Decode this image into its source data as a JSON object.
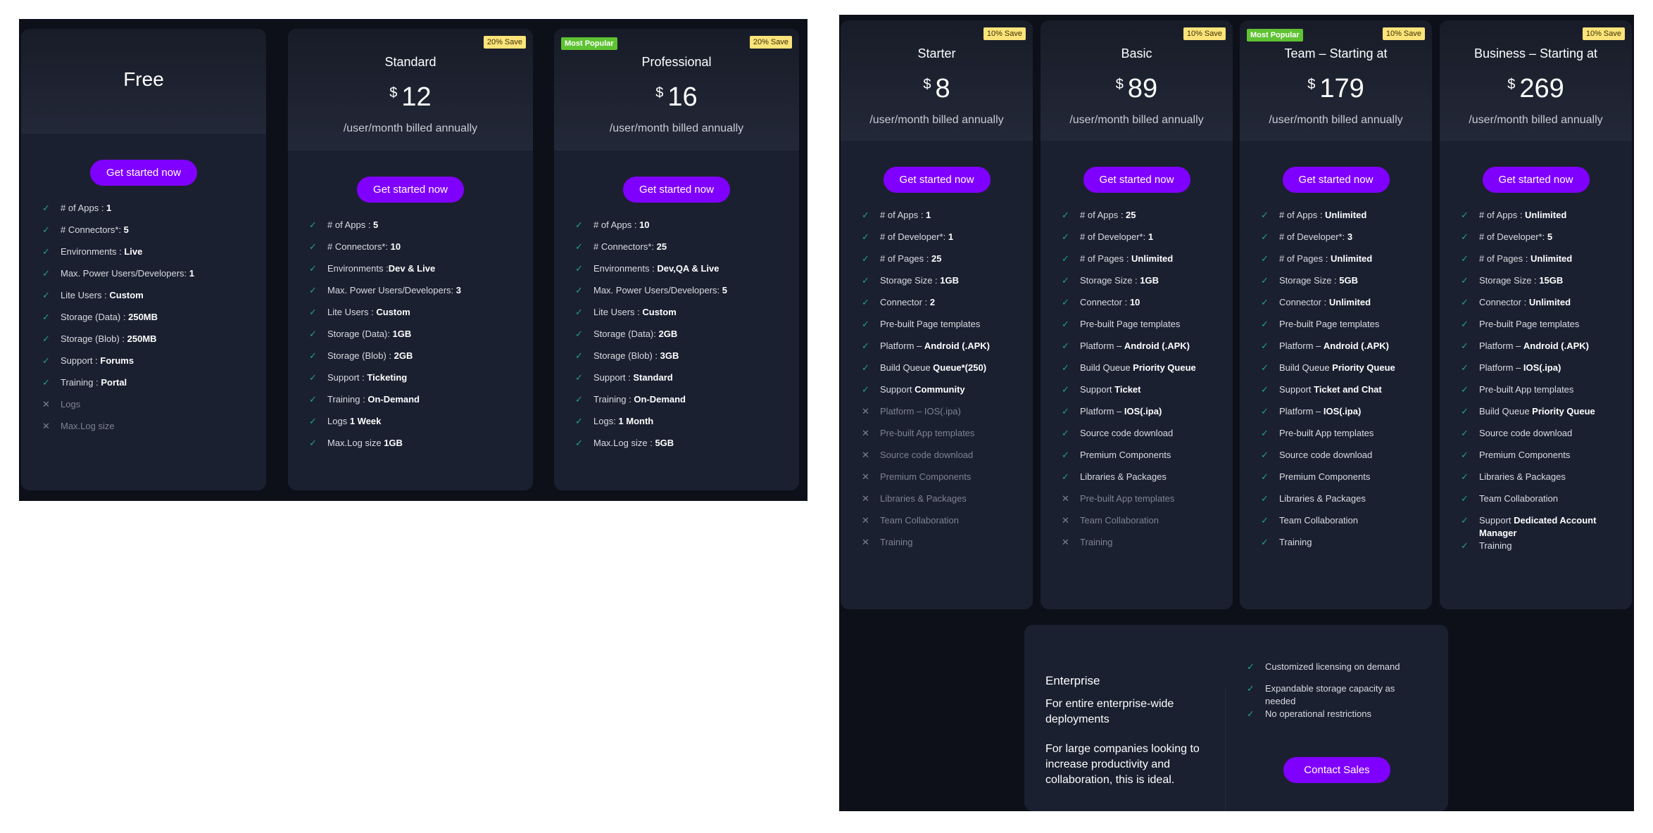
{
  "colors": {
    "accent": "#8000ff",
    "check": "#1fa37a",
    "save_badge": "#fde47a",
    "popular_badge": "#5ec232",
    "panel_bg": "#0d1018",
    "card_bg": "#1b2030"
  },
  "icons": {
    "included": "check-icon",
    "excluded": "x-icon"
  },
  "left_plans": [
    {
      "title": "Free",
      "cta": "Get started now",
      "features": [
        {
          "ok": true,
          "label": "# of Apps : ",
          "value": "1"
        },
        {
          "ok": true,
          "label": "# Connectors*: ",
          "value": "5"
        },
        {
          "ok": true,
          "label": "Environments : ",
          "value": "Live"
        },
        {
          "ok": true,
          "label": "Max. Power Users/Developers: ",
          "value": "1"
        },
        {
          "ok": true,
          "label": "Lite Users : ",
          "value": "Custom"
        },
        {
          "ok": true,
          "label": "Storage (Data) : ",
          "value": "250MB"
        },
        {
          "ok": true,
          "label": "Storage (Blob) : ",
          "value": "250MB"
        },
        {
          "ok": true,
          "label": "Support : ",
          "value": "Forums"
        },
        {
          "ok": true,
          "label": "Training : ",
          "value": "Portal"
        },
        {
          "ok": false,
          "label": "Logs",
          "value": ""
        },
        {
          "ok": false,
          "label": "Max.Log size",
          "value": ""
        }
      ]
    },
    {
      "title": "Standard",
      "save": "20% Save",
      "currency": "$",
      "price": "12",
      "per": "/user/month billed annually",
      "cta": "Get started now",
      "features": [
        {
          "ok": true,
          "label": "# of Apps : ",
          "value": "5"
        },
        {
          "ok": true,
          "label": "# Connectors*: ",
          "value": "10"
        },
        {
          "ok": true,
          "label": "Environments :",
          "value": "Dev & Live"
        },
        {
          "ok": true,
          "label": "Max. Power Users/Developers: ",
          "value": "3"
        },
        {
          "ok": true,
          "label": "Lite Users : ",
          "value": "Custom"
        },
        {
          "ok": true,
          "label": "Storage (Data): ",
          "value": "1GB"
        },
        {
          "ok": true,
          "label": "Storage (Blob) : ",
          "value": "2GB"
        },
        {
          "ok": true,
          "label": "Support : ",
          "value": "Ticketing"
        },
        {
          "ok": true,
          "label": "Training : ",
          "value": "On-Demand"
        },
        {
          "ok": true,
          "label": "Logs ",
          "value": "1 Week"
        },
        {
          "ok": true,
          "label": "Max.Log size ",
          "value": "1GB"
        }
      ]
    },
    {
      "title": "Professional",
      "save": "20% Save",
      "popular": "Most Popular",
      "currency": "$",
      "price": "16",
      "per": "/user/month billed annually",
      "cta": "Get started now",
      "features": [
        {
          "ok": true,
          "label": "# of Apps : ",
          "value": "10"
        },
        {
          "ok": true,
          "label": "# Connectors*: ",
          "value": "25"
        },
        {
          "ok": true,
          "label": "Environments : ",
          "value": "Dev,QA & Live"
        },
        {
          "ok": true,
          "label": "Max. Power Users/Developers: ",
          "value": "5"
        },
        {
          "ok": true,
          "label": "Lite Users : ",
          "value": "Custom"
        },
        {
          "ok": true,
          "label": "Storage (Data): ",
          "value": "2GB"
        },
        {
          "ok": true,
          "label": "Storage (Blob) : ",
          "value": "3GB"
        },
        {
          "ok": true,
          "label": "Support : ",
          "value": "Standard"
        },
        {
          "ok": true,
          "label": "Training : ",
          "value": "On-Demand"
        },
        {
          "ok": true,
          "label": "Logs: ",
          "value": "1 Month"
        },
        {
          "ok": true,
          "label": "Max.Log size : ",
          "value": "5GB"
        }
      ]
    }
  ],
  "right_plans": [
    {
      "title": "Starter",
      "save": "10% Save",
      "currency": "$",
      "price": "8",
      "per": "/user/month billed annually",
      "cta": "Get started now",
      "features": [
        {
          "ok": true,
          "label": "# of Apps : ",
          "value": "1"
        },
        {
          "ok": true,
          "label": "# of Developer*: ",
          "value": "1"
        },
        {
          "ok": true,
          "label": "# of Pages : ",
          "value": "25"
        },
        {
          "ok": true,
          "label": "Storage Size : ",
          "value": "1GB"
        },
        {
          "ok": true,
          "label": "Connector : ",
          "value": "2"
        },
        {
          "ok": true,
          "label": "Pre-built Page templates",
          "value": ""
        },
        {
          "ok": true,
          "label": "Platform – ",
          "value": "Android (.APK)"
        },
        {
          "ok": true,
          "label": "Build Queue ",
          "value": "Queue*(250)"
        },
        {
          "ok": true,
          "label": "Support ",
          "value": "Community"
        },
        {
          "ok": false,
          "label": "Platform – IOS(.ipa)",
          "value": ""
        },
        {
          "ok": false,
          "label": "Pre-built App templates",
          "value": ""
        },
        {
          "ok": false,
          "label": "Source code download",
          "value": ""
        },
        {
          "ok": false,
          "label": "Premium Components",
          "value": ""
        },
        {
          "ok": false,
          "label": "Libraries & Packages",
          "value": ""
        },
        {
          "ok": false,
          "label": "Team Collaboration",
          "value": ""
        },
        {
          "ok": false,
          "label": "Training",
          "value": ""
        }
      ]
    },
    {
      "title": "Basic",
      "save": "10% Save",
      "currency": "$",
      "price": "89",
      "per": "/user/month billed annually",
      "cta": "Get started now",
      "features": [
        {
          "ok": true,
          "label": "# of Apps : ",
          "value": "25"
        },
        {
          "ok": true,
          "label": "# of Developer*: ",
          "value": "1"
        },
        {
          "ok": true,
          "label": "# of Pages : ",
          "value": "Unlimited"
        },
        {
          "ok": true,
          "label": "Storage Size : ",
          "value": "1GB"
        },
        {
          "ok": true,
          "label": "Connector : ",
          "value": "10"
        },
        {
          "ok": true,
          "label": "Pre-built Page templates",
          "value": ""
        },
        {
          "ok": true,
          "label": "Platform – ",
          "value": "Android (.APK)"
        },
        {
          "ok": true,
          "label": "Build Queue ",
          "value": "Priority Queue"
        },
        {
          "ok": true,
          "label": "Support ",
          "value": "Ticket"
        },
        {
          "ok": true,
          "label": "Platform – ",
          "value": "IOS(.ipa)"
        },
        {
          "ok": true,
          "label": "Source code download",
          "value": ""
        },
        {
          "ok": true,
          "label": "Premium Components",
          "value": ""
        },
        {
          "ok": true,
          "label": "Libraries & Packages",
          "value": ""
        },
        {
          "ok": false,
          "label": "Pre-built App templates",
          "value": ""
        },
        {
          "ok": false,
          "label": "Team Collaboration",
          "value": ""
        },
        {
          "ok": false,
          "label": "Training",
          "value": ""
        }
      ]
    },
    {
      "title": "Team – Starting at",
      "save": "10% Save",
      "popular": "Most Popular",
      "currency": "$",
      "price": "179",
      "per": "/user/month billed annually",
      "cta": "Get started now",
      "features": [
        {
          "ok": true,
          "label": "# of Apps : ",
          "value": "Unlimited"
        },
        {
          "ok": true,
          "label": "# of Developer*: ",
          "value": "3"
        },
        {
          "ok": true,
          "label": "# of Pages : ",
          "value": "Unlimited"
        },
        {
          "ok": true,
          "label": "Storage Size : ",
          "value": "5GB"
        },
        {
          "ok": true,
          "label": "Connector : ",
          "value": "Unlimited"
        },
        {
          "ok": true,
          "label": "Pre-built Page templates",
          "value": ""
        },
        {
          "ok": true,
          "label": "Platform – ",
          "value": "Android (.APK)"
        },
        {
          "ok": true,
          "label": "Build Queue ",
          "value": "Priority Queue"
        },
        {
          "ok": true,
          "label": "Support ",
          "value": "Ticket and Chat"
        },
        {
          "ok": true,
          "label": "Platform – ",
          "value": "IOS(.ipa)"
        },
        {
          "ok": true,
          "label": "Pre-built App templates",
          "value": ""
        },
        {
          "ok": true,
          "label": "Source code download",
          "value": ""
        },
        {
          "ok": true,
          "label": "Premium Components",
          "value": ""
        },
        {
          "ok": true,
          "label": "Libraries & Packages",
          "value": ""
        },
        {
          "ok": true,
          "label": "Team Collaboration",
          "value": ""
        },
        {
          "ok": true,
          "label": "Training",
          "value": ""
        }
      ]
    },
    {
      "title": "Business – Starting at",
      "save": "10% Save",
      "currency": "$",
      "price": "269",
      "per": "/user/month billed annually",
      "cta": "Get started now",
      "features": [
        {
          "ok": true,
          "label": "# of Apps : ",
          "value": "Unlimited"
        },
        {
          "ok": true,
          "label": "# of Developer*: ",
          "value": "5"
        },
        {
          "ok": true,
          "label": "# of Pages : ",
          "value": "Unlimited"
        },
        {
          "ok": true,
          "label": "Storage Size : ",
          "value": "15GB"
        },
        {
          "ok": true,
          "label": "Connector : ",
          "value": "Unlimited"
        },
        {
          "ok": true,
          "label": "Pre-built Page templates",
          "value": ""
        },
        {
          "ok": true,
          "label": "Platform – ",
          "value": "Android (.APK)"
        },
        {
          "ok": true,
          "label": "Platform – ",
          "value": "IOS(.ipa)"
        },
        {
          "ok": true,
          "label": "Pre-built App templates",
          "value": ""
        },
        {
          "ok": true,
          "label": "Build Queue ",
          "value": "Priority Queue"
        },
        {
          "ok": true,
          "label": "Source code download",
          "value": ""
        },
        {
          "ok": true,
          "label": "Premium Components",
          "value": ""
        },
        {
          "ok": true,
          "label": "Libraries & Packages",
          "value": ""
        },
        {
          "ok": true,
          "label": "Team Collaboration",
          "value": ""
        },
        {
          "ok": true,
          "label": "Support ",
          "value": "Dedicated Account Manager"
        },
        {
          "ok": true,
          "label": "Training",
          "value": ""
        }
      ]
    }
  ],
  "enterprise": {
    "title": "Enterprise",
    "subtitle": "For entire enterprise-wide deployments",
    "description": "For large companies looking to increase productivity and collaboration, this is ideal.",
    "features": [
      {
        "ok": true,
        "label": "Customized licensing on demand",
        "value": ""
      },
      {
        "ok": true,
        "label": "Expandable storage capacity as needed",
        "value": ""
      },
      {
        "ok": true,
        "label": "No operational restrictions",
        "value": ""
      }
    ],
    "cta": "Contact Sales"
  }
}
